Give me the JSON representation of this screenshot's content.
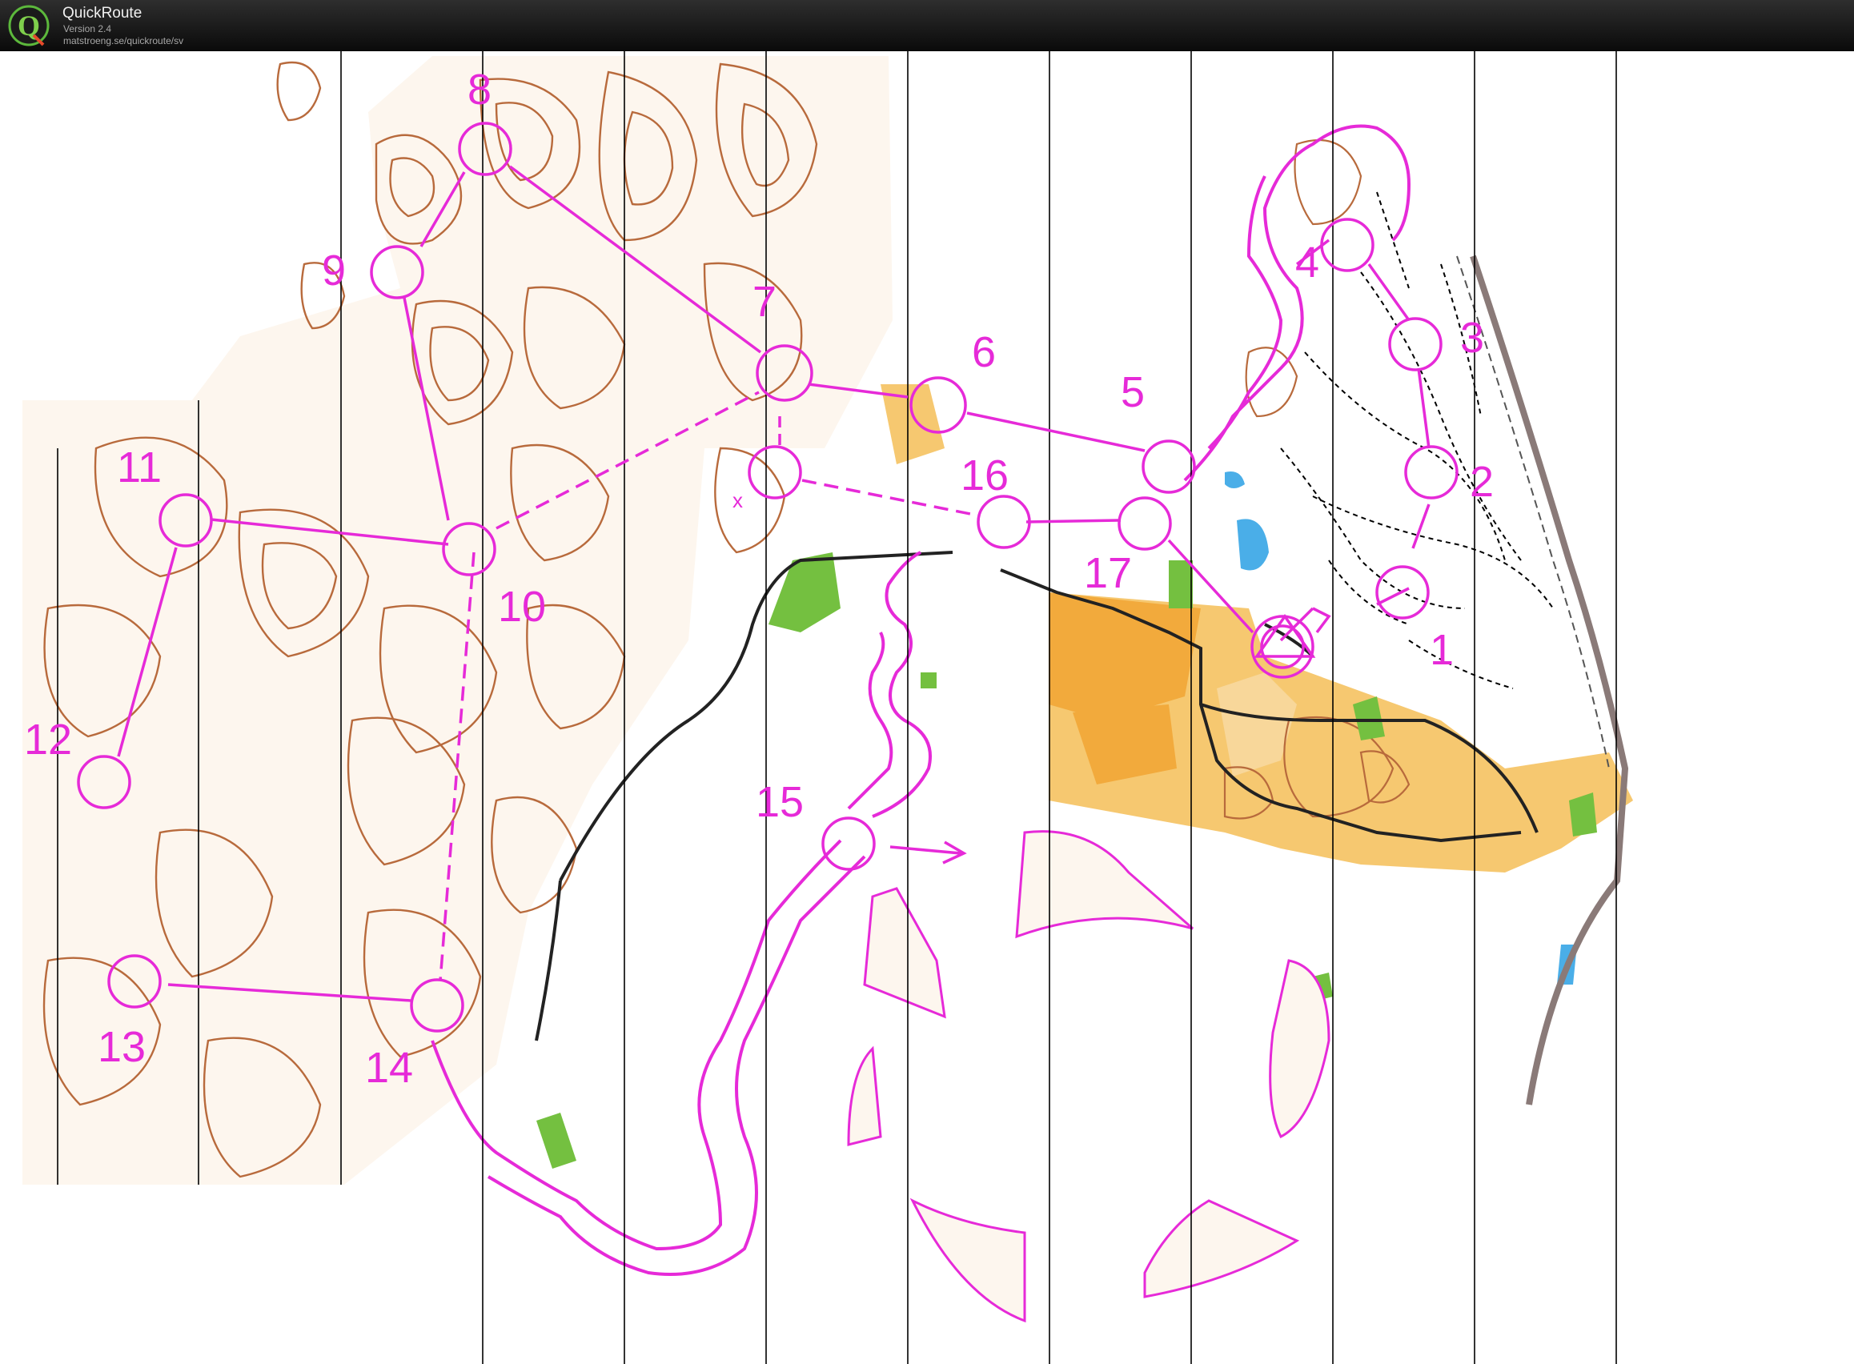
{
  "app": {
    "name": "QuickRoute",
    "version": "Version 2.4",
    "url": "matstroeng.se/quickroute/sv",
    "logo_letter": "Q"
  },
  "colors": {
    "course": "#e62ad8",
    "contour": "#b86a3c",
    "open_land": "#f6c870",
    "open_land_dark": "#f2aa3c",
    "vegetation": "#74c040",
    "water": "#4aaee8",
    "road": "#222222",
    "railway": "#8a7a78",
    "stripes": "#000000"
  },
  "icons": {
    "logo": "quickroute-logo-icon",
    "direction": "arrow-right-icon"
  },
  "controls": [
    {
      "label": "1"
    },
    {
      "label": "2"
    },
    {
      "label": "3"
    },
    {
      "label": "4"
    },
    {
      "label": "5"
    },
    {
      "label": "6"
    },
    {
      "label": "7"
    },
    {
      "label": "8"
    },
    {
      "label": "9"
    },
    {
      "label": "10"
    },
    {
      "label": "11"
    },
    {
      "label": "12"
    },
    {
      "label": "13"
    },
    {
      "label": "14"
    },
    {
      "label": "15"
    },
    {
      "label": "16"
    },
    {
      "label": "17"
    }
  ]
}
